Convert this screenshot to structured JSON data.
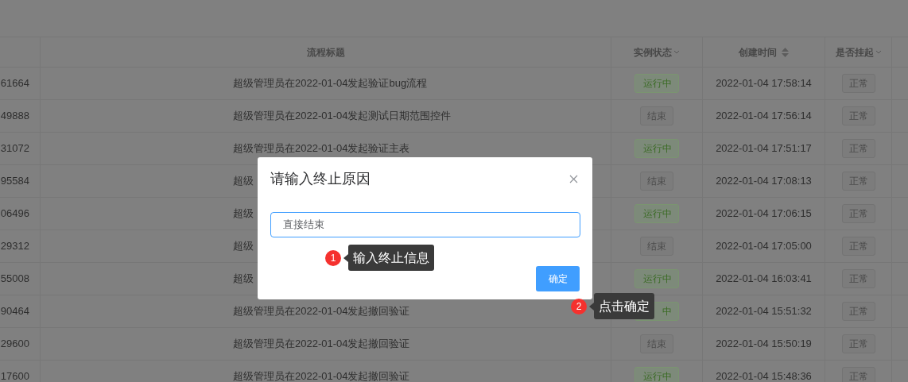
{
  "table": {
    "columns": [
      "流程标题",
      "实例状态",
      "创建时间",
      "是否挂起"
    ],
    "rows": [
      {
        "id": "61664",
        "title": "超级管理员在2022-01-04发起验证bug流程",
        "status": {
          "label": "运行中",
          "kind": "running"
        },
        "created": "2022-01-04 17:58:14",
        "suspended": "正常"
      },
      {
        "id": "49888",
        "title": "超级管理员在2022-01-04发起测试日期范围控件",
        "status": {
          "label": "结束",
          "kind": "ended"
        },
        "created": "2022-01-04 17:56:14",
        "suspended": "正常"
      },
      {
        "id": "31072",
        "title": "超级管理员在2022-01-04发起验证主表",
        "status": {
          "label": "运行中",
          "kind": "running"
        },
        "created": "2022-01-04 17:51:17",
        "suspended": "正常"
      },
      {
        "id": "95584",
        "title": "超级",
        "status": {
          "label": "结束",
          "kind": "ended"
        },
        "created": "2022-01-04 17:08:13",
        "suspended": "正常"
      },
      {
        "id": "06496",
        "title": "超级",
        "status": {
          "label": "运行中",
          "kind": "running"
        },
        "created": "2022-01-04 17:06:15",
        "suspended": "正常"
      },
      {
        "id": "29312",
        "title": "超级",
        "status": {
          "label": "结束",
          "kind": "ended"
        },
        "created": "2022-01-04 17:05:00",
        "suspended": "正常"
      },
      {
        "id": "55008",
        "title": "超级",
        "status": {
          "label": "运行中",
          "kind": "running"
        },
        "created": "2022-01-04 16:03:41",
        "suspended": "正常"
      },
      {
        "id": "90464",
        "title": "超级管理员在2022-01-04发起撤回验证",
        "status": {
          "label": "中",
          "kind": "running"
        },
        "created": "2022-01-04 15:51:32",
        "suspended": "正常"
      },
      {
        "id": "29600",
        "title": "超级管理员在2022-01-04发起撤回验证",
        "status": {
          "label": "结束",
          "kind": "ended"
        },
        "created": "2022-01-04 15:50:19",
        "suspended": "正常"
      },
      {
        "id": "17600",
        "title": "超级管理员在2022-01-04发起撤回验证",
        "status": {
          "label": "运行中",
          "kind": "running"
        },
        "created": "2022-01-04 15:48:36",
        "suspended": "正常"
      }
    ]
  },
  "dialog": {
    "title": "请输入终止原因",
    "input": {
      "value": "直接结束"
    },
    "button": "确定"
  },
  "hints": [
    {
      "number": "1",
      "text": "输入终止信息"
    },
    {
      "number": "2",
      "text": "点击确定"
    }
  ]
}
